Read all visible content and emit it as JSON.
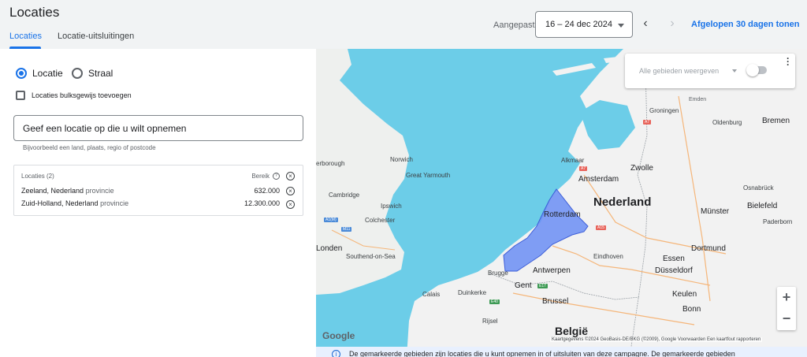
{
  "header": {
    "title": "Locaties",
    "tabs": [
      {
        "label": "Locaties",
        "active": true
      },
      {
        "label": "Locatie-uitsluitingen",
        "active": false
      }
    ],
    "date_label": "Aangepast",
    "date_value": "16 – 24 dec 2024",
    "show_30_days": "Afgelopen 30 dagen tonen"
  },
  "panel": {
    "radio_location": "Locatie",
    "radio_radius": "Straal",
    "bulk_add": "Locaties bulksgewijs toevoegen",
    "input_placeholder": "Geef een locatie op die u wilt opnemen",
    "input_helper": "Bijvoorbeeld een land, plaats, regio of postcode",
    "table": {
      "title": "Locaties (2)",
      "reach_header": "Bereik",
      "rows": [
        {
          "name": "Zeeland, Nederland",
          "type": "provincie",
          "reach": "632.000"
        },
        {
          "name": "Zuid-Holland, Nederland",
          "type": "provincie",
          "reach": "12.300.000"
        }
      ]
    }
  },
  "map": {
    "overlay_select": "Alle gebieden weergeven",
    "labels": {
      "nederland": "Nederland",
      "belgie": "België",
      "amsterdam": "Amsterdam",
      "rotterdam": "Rotterdam",
      "antwerpen": "Antwerpen",
      "brussel": "Brussel",
      "gent": "Gent",
      "eindhoven": "Eindhoven",
      "dusseldorf": "Düsseldorf",
      "koln": "Keulen",
      "bonn": "Bonn",
      "dortmund": "Dortmund",
      "essen": "Essen",
      "munster": "Münster",
      "bielefeld": "Bielefeld",
      "osnabruck": "Osnabrück",
      "bremen": "Bremen",
      "oldenburg": "Oldenburg",
      "groningen": "Groningen",
      "emden": "Emden",
      "zwolle": "Zwolle",
      "alkmaar": "Alkmaar",
      "london": "Londen",
      "cambridge": "Cambridge",
      "ipswich": "Ipswich",
      "colchester": "Colchester",
      "norwich": "Norwich",
      "great_yarmouth": "Great Yarmouth",
      "southend": "Southend-on-Sea",
      "calais": "Calais",
      "duinkerke": "Duinkerke",
      "brugge": "Brugge",
      "rijsel": "Rijsel",
      "paderborn": "Paderborn",
      "borough": "erborough"
    },
    "attribution": "Kaartgegevens ©2024 GeoBasis-DE/BKG (©2009), Google   Voorwaarden   Een kaartfout rapporteren",
    "google": "Google",
    "info_text": "De gemarkeerde gebieden zijn locaties die u kunt opnemen in of uitsluiten van deze campagne. De gemarkeerde gebieden"
  },
  "colors": {
    "accent": "#1a73e8",
    "sea": "#6ccde8",
    "land": "#f2f2f2",
    "highlight": "#6b8ef5"
  }
}
